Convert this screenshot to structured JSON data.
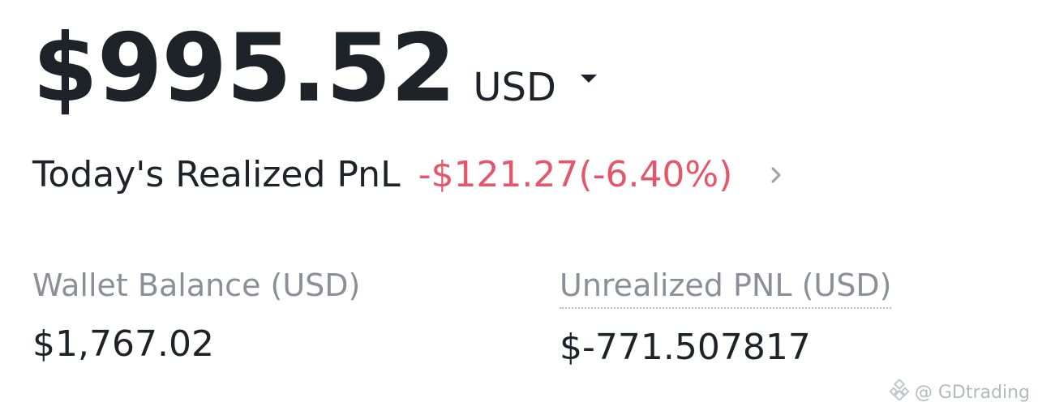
{
  "balance": {
    "amount": "$995.52",
    "currency": "USD",
    "dropdown_icon": "caret-down-icon"
  },
  "pnl": {
    "label": "Today's Realized PnL",
    "value": "-$121.27(-6.40%)",
    "value_color": "#e5566a",
    "chevron_icon": "chevron-right-icon"
  },
  "wallet": {
    "label": "Wallet Balance (USD)",
    "value": "$1,767.02"
  },
  "unrealized": {
    "label": "Unrealized PNL (USD)",
    "value": "$-771.507817"
  },
  "watermark": {
    "text": "@ GDtrading",
    "icon": "logo-icon"
  },
  "colors": {
    "primary_text": "#1e2329",
    "secondary_text": "#8a8f98",
    "negative": "#e5566a",
    "background": "#ffffff"
  }
}
